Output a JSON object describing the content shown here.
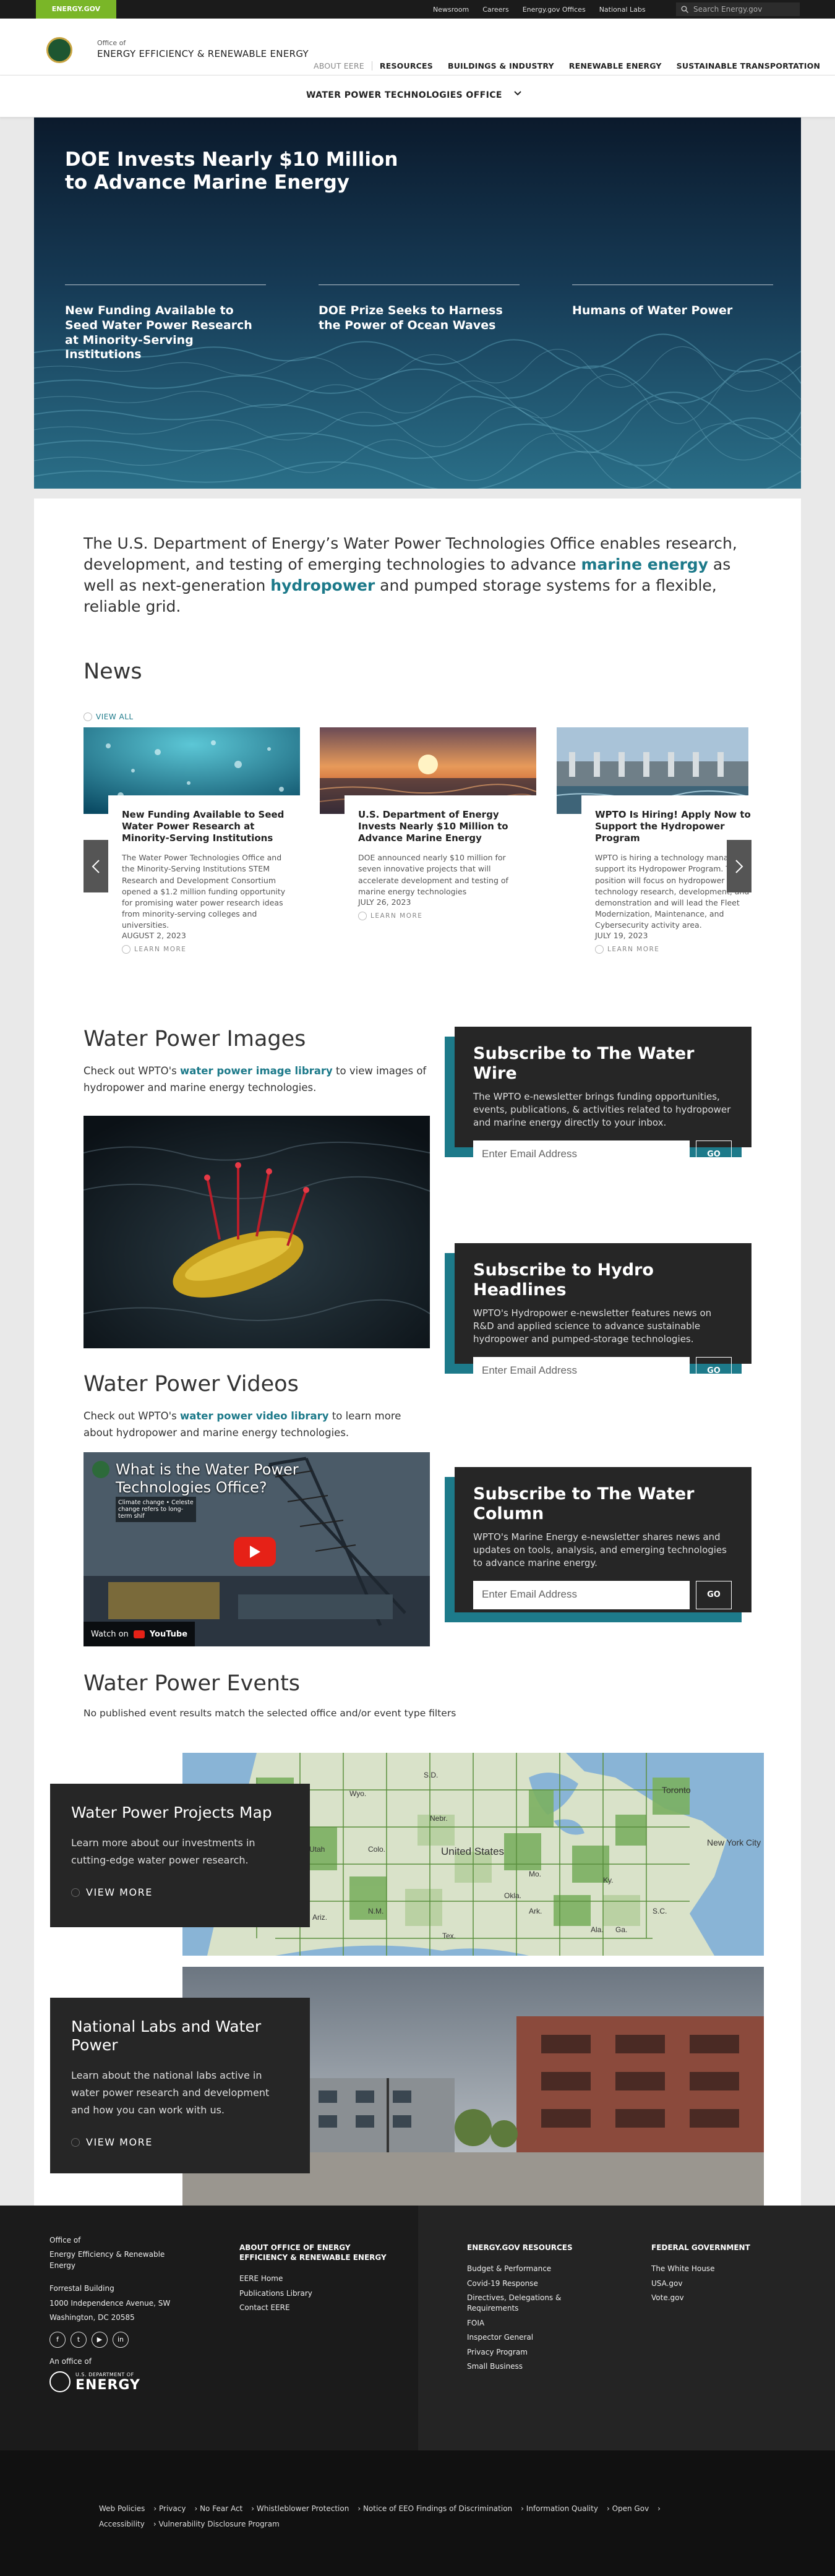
{
  "topbar": {
    "energy_tab": "ENERGY.GOV",
    "links": [
      "Newsroom",
      "Careers",
      "Energy.gov Offices",
      "National Labs"
    ],
    "search_placeholder": "Search Energy.gov"
  },
  "header": {
    "office_of": "Office of",
    "office_name": "ENERGY EFFICIENCY & RENEWABLE ENERGY",
    "nav": [
      "ABOUT EERE",
      "RESOURCES",
      "BUILDINGS & INDUSTRY",
      "RENEWABLE ENERGY",
      "SUSTAINABLE TRANSPORTATION"
    ]
  },
  "office_bar": {
    "label": "WATER POWER TECHNOLOGIES OFFICE"
  },
  "hero": {
    "title": "DOE Invests Nearly $10 Million to Advance Marine Energy",
    "items": [
      "New Funding Available to Seed Water Power Research at Minority-Serving Institutions",
      "DOE Prize Seeks to Harness the Power of Ocean Waves",
      "Humans of Water Power"
    ]
  },
  "intro": {
    "part1": "The U.S. Department of Energy’s Water Power Technologies Office enables research, development, and testing of emerging technologies to advance ",
    "kw1": "marine energy",
    "part2": " as well as next-generation ",
    "kw2": "hydropower",
    "part3": " and pumped storage systems for a flexible, reliable grid."
  },
  "news": {
    "heading": "News",
    "view_all": "VIEW ALL",
    "learn_more": "LEARN MORE",
    "cards": [
      {
        "title": "New Funding Available to Seed Water Power Research at Minority-Serving Institutions",
        "body": "The Water Power Technologies Office and the Minority-Serving Institutions STEM Research and Development Consortium opened a $1.2 million funding opportunity for promising water power research ideas from minority-serving colleges and universities.",
        "date": "AUGUST 2, 2023"
      },
      {
        "title": "U.S. Department of Energy Invests Nearly $10 Million to Advance Marine Energy",
        "body": "DOE announced nearly $10 million for seven innovative projects that will accelerate development and testing of marine energy technologies",
        "date": "JULY 26, 2023"
      },
      {
        "title": "WPTO Is Hiring! Apply Now to Support the Hydropower Program",
        "body": "WPTO is hiring a technology manager to support its Hydropower Program. This position will focus on hydropower technology research, development, and demonstration and will lead the Fleet Modernization, Maintenance, and Cybersecurity activity area.",
        "date": "JULY 19, 2023"
      }
    ]
  },
  "images": {
    "heading": "Water Power Images",
    "text1": "Check out WPTO's ",
    "link": "water power image library",
    "text2": " to view images of hydropower and marine energy technologies."
  },
  "videos": {
    "heading": "Water Power Videos",
    "text1": "Check out WPTO's ",
    "link": "water power video library",
    "text2": " to learn more about hydropower and marine energy technologies.",
    "video_title": "What is the Water Power Technologies Office?",
    "caption": "Climate change • Celeste change refers to long-term shif",
    "watch_on": "Watch on",
    "youtube": "YouTube"
  },
  "subscribe": [
    {
      "title": "Subscribe to The Water Wire",
      "body": "The WPTO e-newsletter brings funding opportunities, events, publications, & activities related to hydropower and marine energy directly to your inbox.",
      "placeholder": "Enter Email Address",
      "button": "GO"
    },
    {
      "title": "Subscribe to Hydro Headlines",
      "body": "WPTO's Hydropower e-newsletter features news on R&D and applied science to advance sustainable hydropower and pumped-storage technologies.",
      "placeholder": "Enter Email Address",
      "button": "GO"
    },
    {
      "title": "Subscribe to The Water Column",
      "body": "WPTO's Marine Energy e-newsletter shares news and updates on tools, analysis, and emerging technologies to advance marine energy.",
      "placeholder": "Enter Email Address",
      "button": "GO"
    }
  ],
  "events": {
    "heading": "Water Power Events",
    "empty": "No published event results match the selected office and/or event type filters"
  },
  "map_card": {
    "title": "Water Power Projects Map",
    "body": "Learn more about our investments in cutting-edge water power research.",
    "cta": "VIEW MORE",
    "labels": {
      "us": "United States",
      "toronto": "Toronto",
      "newyork": "New York City",
      "sd": "S.D.",
      "nebr": "Nebr.",
      "colo": "Colo.",
      "nm": "N.M.",
      "tex": "Tex.",
      "okla": "Okla.",
      "ark": "Ark.",
      "mo": "Mo.",
      "ga": "Ga.",
      "sc": "S.C.",
      "ala": "Ala.",
      "ky": "Ky.",
      "wyo": "Wyo.",
      "utah": "Utah",
      "ariz": "Ariz."
    }
  },
  "labs_card": {
    "title": "National Labs and Water Power",
    "body": "Learn about the national labs active in water power research and development and how you can work with us.",
    "cta": "VIEW MORE"
  },
  "footer": {
    "office_of": "Office of",
    "office_name": "Energy Efficiency & Renewable Energy",
    "address": [
      "Forrestal Building",
      "1000 Independence Avenue, SW",
      "Washington, DC 20585"
    ],
    "an_office_of": "An office of",
    "doe_small": "U.S. DEPARTMENT OF",
    "doe_big": "ENERGY",
    "col1_heading": "ABOUT OFFICE OF ENERGY EFFICIENCY & RENEWABLE ENERGY",
    "col1_items": [
      "EERE Home",
      "Publications Library",
      "Contact EERE"
    ],
    "col2_heading": "ENERGY.GOV RESOURCES",
    "col2_items": [
      "Budget & Performance",
      "Covid-19 Response",
      "Directives, Delegations & Requirements",
      "FOIA",
      "Inspector General",
      "Privacy Program",
      "Small Business"
    ],
    "col3_heading": "FEDERAL GOVERNMENT",
    "col3_items": [
      "The White House",
      "USA.gov",
      "Vote.gov"
    ],
    "bottom_links": [
      "Web Policies",
      "Privacy",
      "No Fear Act",
      "Whistleblower Protection",
      "Notice of EEO Findings of Discrimination",
      "Information Quality",
      "Open Gov",
      "Accessibility",
      "Vulnerability Disclosure Program"
    ]
  },
  "colors": {
    "accent": "#1d7a8a",
    "dark_panel": "#262626",
    "energy_green": "#7ab628"
  }
}
